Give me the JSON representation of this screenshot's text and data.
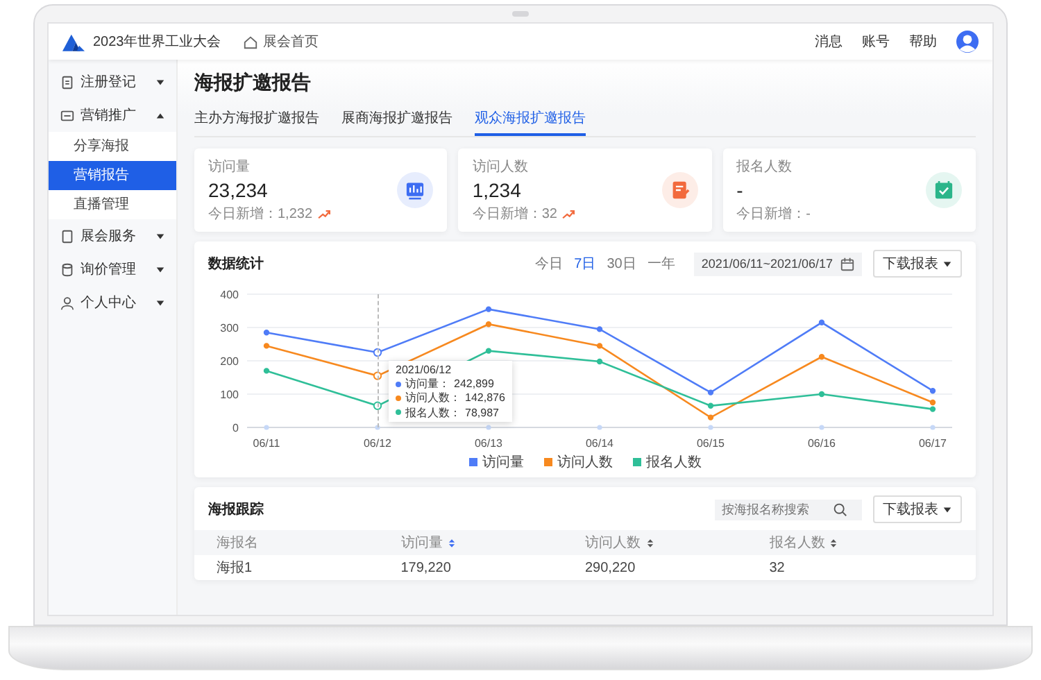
{
  "header": {
    "brand": "2023年世界工业大会",
    "home_link": "展会首页",
    "links": [
      "消息",
      "账号",
      "帮助"
    ]
  },
  "sidebar": {
    "items": [
      {
        "label": "注册登记",
        "kind": "form",
        "expanded": false
      },
      {
        "label": "营销推广",
        "kind": "promo",
        "expanded": true,
        "children": [
          {
            "label": "分享海报",
            "selected": false
          },
          {
            "label": "营销报告",
            "selected": true
          },
          {
            "label": "直播管理",
            "selected": false
          }
        ]
      },
      {
        "label": "展会服务",
        "kind": "tablet",
        "expanded": false
      },
      {
        "label": "询价管理",
        "kind": "db",
        "expanded": false
      },
      {
        "label": "个人中心",
        "kind": "user",
        "expanded": false
      }
    ]
  },
  "page_title": "海报扩邀报告",
  "tabs": [
    {
      "label": "主办方海报扩邀报告",
      "selected": false
    },
    {
      "label": "展商海报扩邀报告",
      "selected": false
    },
    {
      "label": "观众海报扩邀报告",
      "selected": true
    }
  ],
  "stats": [
    {
      "label": "访问量",
      "value": "23,234",
      "today": "今日新增：1,232",
      "trend_up": true,
      "kind": "chart",
      "color": "#3d6df2"
    },
    {
      "label": "访问人数",
      "value": "1,234",
      "today": "今日新增：32",
      "trend_up": true,
      "kind": "edit",
      "color": "#f26a3d"
    },
    {
      "label": "报名人数",
      "value": "-",
      "today": "今日新增：-",
      "trend_up": false,
      "kind": "calendar",
      "color": "#2bb58a"
    }
  ],
  "stats_panel": {
    "title": "数据统计",
    "ranges": [
      {
        "label": "今日",
        "selected": false
      },
      {
        "label": "7日",
        "selected": true
      },
      {
        "label": "30日",
        "selected": false
      },
      {
        "label": "一年",
        "selected": false
      }
    ],
    "date_range": "2021/06/11~2021/06/17",
    "download": "下载报表",
    "chart_data": {
      "type": "line",
      "grid": true,
      "categories": [
        "06/11",
        "06/12",
        "06/13",
        "06/14",
        "06/15",
        "06/16",
        "06/17"
      ],
      "yticks": [
        0,
        100,
        200,
        300,
        400
      ],
      "ylim": [
        0,
        400
      ],
      "series": [
        {
          "name": "访问量",
          "color": "#4f7cf7",
          "marker": true,
          "values": [
            285,
            225,
            355,
            295,
            105,
            315,
            110
          ]
        },
        {
          "name": "访问人数",
          "color": "#f7891f",
          "marker": true,
          "values": [
            245,
            155,
            310,
            245,
            30,
            212,
            75
          ]
        },
        {
          "name": "报名人数",
          "color": "#2fbf98",
          "marker": true,
          "values": [
            170,
            65,
            230,
            198,
            65,
            100,
            55
          ]
        }
      ]
    },
    "tooltip": {
      "title": "2021/06/12",
      "rows": [
        {
          "label": "访问量：",
          "value": "242,899"
        },
        {
          "label": "访问人数：",
          "value": "142,876"
        },
        {
          "label": "报名人数：",
          "value": "78,987"
        }
      ]
    }
  },
  "tracking": {
    "title": "海报跟踪",
    "search": {
      "placeholder": "按海报名称搜索"
    },
    "download": "下载报表",
    "columns": [
      {
        "label": "海报名",
        "sortable": false
      },
      {
        "label": "访问量",
        "sortable": true
      },
      {
        "label": "访问人数",
        "sortable": true
      },
      {
        "label": "报名人数",
        "sortable": true
      }
    ],
    "rows": [
      [
        "海报1",
        "179,220",
        "290,220",
        "32"
      ]
    ]
  }
}
